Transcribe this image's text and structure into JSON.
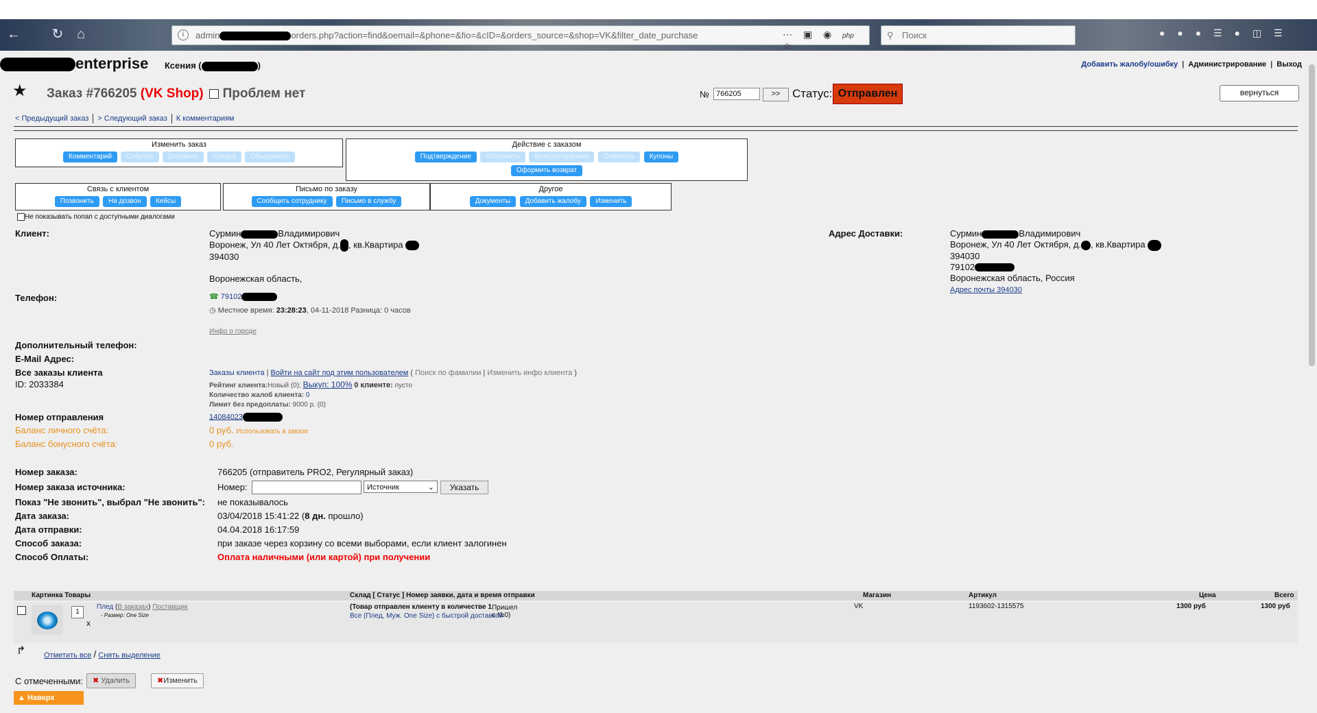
{
  "browser": {
    "url_prefix": "admin",
    "url_rest": "orders.php?action=find&oemail=&phone=&fio=&cID=&orders_source=&shop=VK&filter_date_purchase",
    "url_icon_php": "php",
    "search_placeholder": "Поиск"
  },
  "header": {
    "logo_text": "enterprise",
    "user_prefix": "Ксения (",
    "user_suffix": ")",
    "links": {
      "complaint": "Добавить жалобу/ошибку",
      "admin": "Администрирование",
      "logout": "Выход"
    },
    "sep": "|"
  },
  "order": {
    "title": "Заказ #766205",
    "shop": "(VK Shop)",
    "problem": "Проблем нет",
    "num_label": "№",
    "num_value": "766205",
    "go_label": ">>",
    "status_label": "Статус:",
    "status_value": "Отправлен",
    "status_color": "#d83b0b",
    "back_label": "вернуться"
  },
  "navlinks": {
    "prev": "< Предыдущий заказ",
    "next": "> Следующий заказ",
    "comments": "К комментариям"
  },
  "boxes": {
    "change": {
      "head": "Изменить заказ",
      "buttons": [
        "Комментарий",
        "Собрать",
        "Добавить",
        "Скидка",
        "Объединить"
      ]
    },
    "action": {
      "head": "Действие с заказом",
      "buttons": [
        "Подтверждение",
        "Отправить",
        "Возврат-причина",
        "Отменить",
        "Купоны"
      ],
      "extra": "Оформить возврат"
    },
    "client": {
      "head": "Связь с клиентом",
      "buttons": [
        "Позвонить",
        "На дозвон",
        "Кейсы"
      ]
    },
    "letter": {
      "head": "Письмо по заказу",
      "buttons": [
        "Сообщить сотруднику",
        "Письмо в службу"
      ]
    },
    "other": {
      "head": "Другое",
      "buttons": [
        "Документы",
        "Добавить жалобу",
        "Изменить"
      ]
    }
  },
  "noshow": "Не показывать попап с доступными диалогами",
  "client": {
    "label": "Клиент:",
    "name_a": "Сурмин",
    "name_b": "Владимирович",
    "addr_a": "Воронеж, Ул 40 Лет Октября, д.",
    "addr_b": ", кв.Квартира",
    "zip": "394030",
    "region": "Воронежская область,"
  },
  "delivery": {
    "label": "Адрес Доставки:",
    "name_a": "Сурмин",
    "name_b": "Владимирович",
    "addr_a": "Воронеж, Ул 40 Лет Октября, д.",
    "addr_b": ", кв.Квартира",
    "zip": "394030",
    "phone": "79102",
    "region": "Воронежская область, Россия",
    "post_link": "Адрес почты 394030"
  },
  "phone": {
    "label": "Телефон:",
    "value": "79102",
    "local_label": "Местное время:",
    "local_time": "23:28:23",
    "local_date": ", 04-11-2018 Разница: 0 часов",
    "city_info": "Инфо о городе"
  },
  "extra_phone": "Дополнительный телефон:",
  "email": "E-Mail Адрес:",
  "all_orders": {
    "label": "Все заказы клиента",
    "id": "ID: 2033384",
    "links": [
      "Заказы клиента",
      "Войти на сайт под этим пользователем"
    ],
    "paren": [
      "Поиск по фамилии",
      "Изменить инфо клиента"
    ],
    "rating_label": "Рейтинг клиента:",
    "rating_value": "Новый (0);",
    "buyout": "Выкуп: 100%",
    "at_client": "0 клиенте:",
    "empty": "пусто",
    "complaints_label": "Количество жалоб клиента:",
    "complaints_value": "0",
    "limit_label": "Лимит без предоплаты:",
    "limit_value": "9000 р. (0)"
  },
  "shipment": {
    "label": "Номер отправления",
    "value": "14084023"
  },
  "balance": {
    "personal_label": "Баланс личного счёта:",
    "personal_value": "0 руб.",
    "use": "Использовать в заказе",
    "bonus_label": "Баланс бонусного счёта:",
    "bonus_value": "0 руб."
  },
  "details": {
    "order_no_label": "Номер заказа:",
    "order_no_value": "766205 (отправитель PRO2, Регулярный заказ)",
    "source_label": "Номер заказа источника:",
    "source_num_label": "Номер:",
    "source_select": "Источник",
    "source_btn": "Указать",
    "noscall_label": "Показ \"Не звонить\", выбрал \"Не звонить\":",
    "noscall_value": "не показывалось",
    "date_label": "Дата заказа:",
    "date_value": "03/04/2018 15:41:22 (",
    "date_days": "8 дн.",
    "date_tail": " прошло)",
    "ship_label": "Дата отправки:",
    "ship_value": "04.04.2018 16:17:59",
    "method_label": "Способ заказа:",
    "method_value": "при заказе через корзину со всеми выборами, если клиент залогинен",
    "pay_label": "Способ Оплаты:",
    "pay_value": "Оплата наличными (или картой) при получении"
  },
  "table": {
    "headers": [
      "Картинка Товары",
      "Склад [ Статус ] Номер заявки, дата и время отправки",
      "Магазин",
      "Артикул",
      "Цена",
      "Всего"
    ],
    "row": {
      "qty": "1",
      "x": "x",
      "name": "Плед",
      "in_orders": "В заказах",
      "supplier": "Поставщик",
      "size": "- Размер: One Size",
      "status": "(Товар отправлен клиенту в количестве 1",
      "status_tail": " Пришел с №0)",
      "variant": "Все (Плед, Муж. One Size) с быстрой доставкой",
      "shop": "VK",
      "article": "1193602-1315575",
      "price": "1300 руб",
      "total": "1300 руб"
    }
  },
  "select_all": "Отметить все",
  "deselect": "Снять выделение",
  "slash": "/",
  "with_selected": "С отмеченными:",
  "delete": "Удалить",
  "edit": "Изменить",
  "to_top": "Наверх"
}
